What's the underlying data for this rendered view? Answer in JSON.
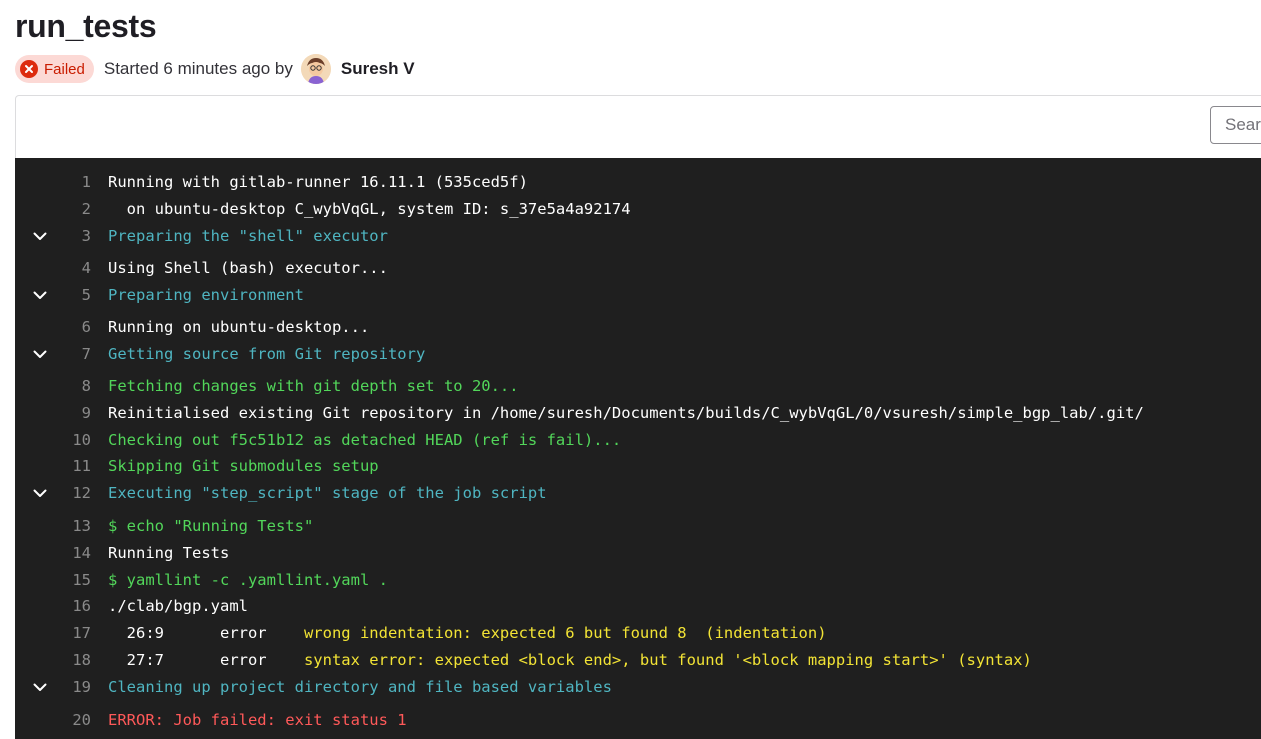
{
  "job": {
    "title": "run_tests",
    "status": "Failed",
    "started_text": "Started 6 minutes ago by",
    "author": "Suresh V"
  },
  "toolbar": {
    "search_placeholder": "Search"
  },
  "log": {
    "lines": [
      {
        "num": "1",
        "text": "Running with gitlab-runner 16.11.1 (535ced5f)",
        "color": "white",
        "collapsible": false
      },
      {
        "num": "2",
        "text": "  on ubuntu-desktop C_wybVqGL, system ID: s_37e5a4a92174",
        "color": "white",
        "collapsible": false
      },
      {
        "num": "3",
        "text": "Preparing the \"shell\" executor",
        "color": "cyan",
        "collapsible": true
      },
      {
        "num": "4",
        "text": "Using Shell (bash) executor...",
        "color": "white",
        "collapsible": false
      },
      {
        "num": "5",
        "text": "Preparing environment",
        "color": "cyan",
        "collapsible": true
      },
      {
        "num": "6",
        "text": "Running on ubuntu-desktop...",
        "color": "white",
        "collapsible": false
      },
      {
        "num": "7",
        "text": "Getting source from Git repository",
        "color": "cyan",
        "collapsible": true
      },
      {
        "num": "8",
        "text": "Fetching changes with git depth set to 20...",
        "color": "green",
        "collapsible": false
      },
      {
        "num": "9",
        "text": "Reinitialised existing Git repository in /home/suresh/Documents/builds/C_wybVqGL/0/vsuresh/simple_bgp_lab/.git/",
        "color": "white",
        "collapsible": false
      },
      {
        "num": "10",
        "text": "Checking out f5c51b12 as detached HEAD (ref is fail)...",
        "color": "green",
        "collapsible": false
      },
      {
        "num": "11",
        "text": "Skipping Git submodules setup",
        "color": "green",
        "collapsible": false
      },
      {
        "num": "12",
        "text": "Executing \"step_script\" stage of the job script",
        "color": "cyan",
        "collapsible": true
      },
      {
        "num": "13",
        "text": "$ echo \"Running Tests\"",
        "color": "green",
        "collapsible": false
      },
      {
        "num": "14",
        "text": "Running Tests",
        "color": "white",
        "collapsible": false
      },
      {
        "num": "15",
        "text": "$ yamllint -c .yamllint.yaml .",
        "color": "green",
        "collapsible": false
      },
      {
        "num": "16",
        "text": "./clab/bgp.yaml",
        "color": "white",
        "collapsible": false
      },
      {
        "num": "17",
        "text": "  26:9      error    ",
        "highlight": "wrong indentation: expected 6 but found 8  (indentation)",
        "color": "white",
        "collapsible": false
      },
      {
        "num": "18",
        "text": "  27:7      error    ",
        "highlight": "syntax error: expected <block end>, but found '<block mapping start>' (syntax)",
        "color": "white",
        "collapsible": false
      },
      {
        "num": "19",
        "text": "Cleaning up project directory and file based variables",
        "color": "cyan",
        "collapsible": true
      },
      {
        "num": "20",
        "text": "ERROR: Job failed: exit status 1",
        "color": "red",
        "collapsible": false
      }
    ]
  },
  "colors": {
    "failed_badge_bg": "#fcd9d5",
    "failed_text": "#c91c00",
    "log_bg": "#1f1f1f",
    "cyan": "#4fb5c1",
    "green": "#52d65a",
    "red": "#ff5959",
    "yellow": "#f2e335"
  },
  "icons": {
    "status": "close-circle-icon",
    "section_toggle": "chevron-down-icon"
  }
}
